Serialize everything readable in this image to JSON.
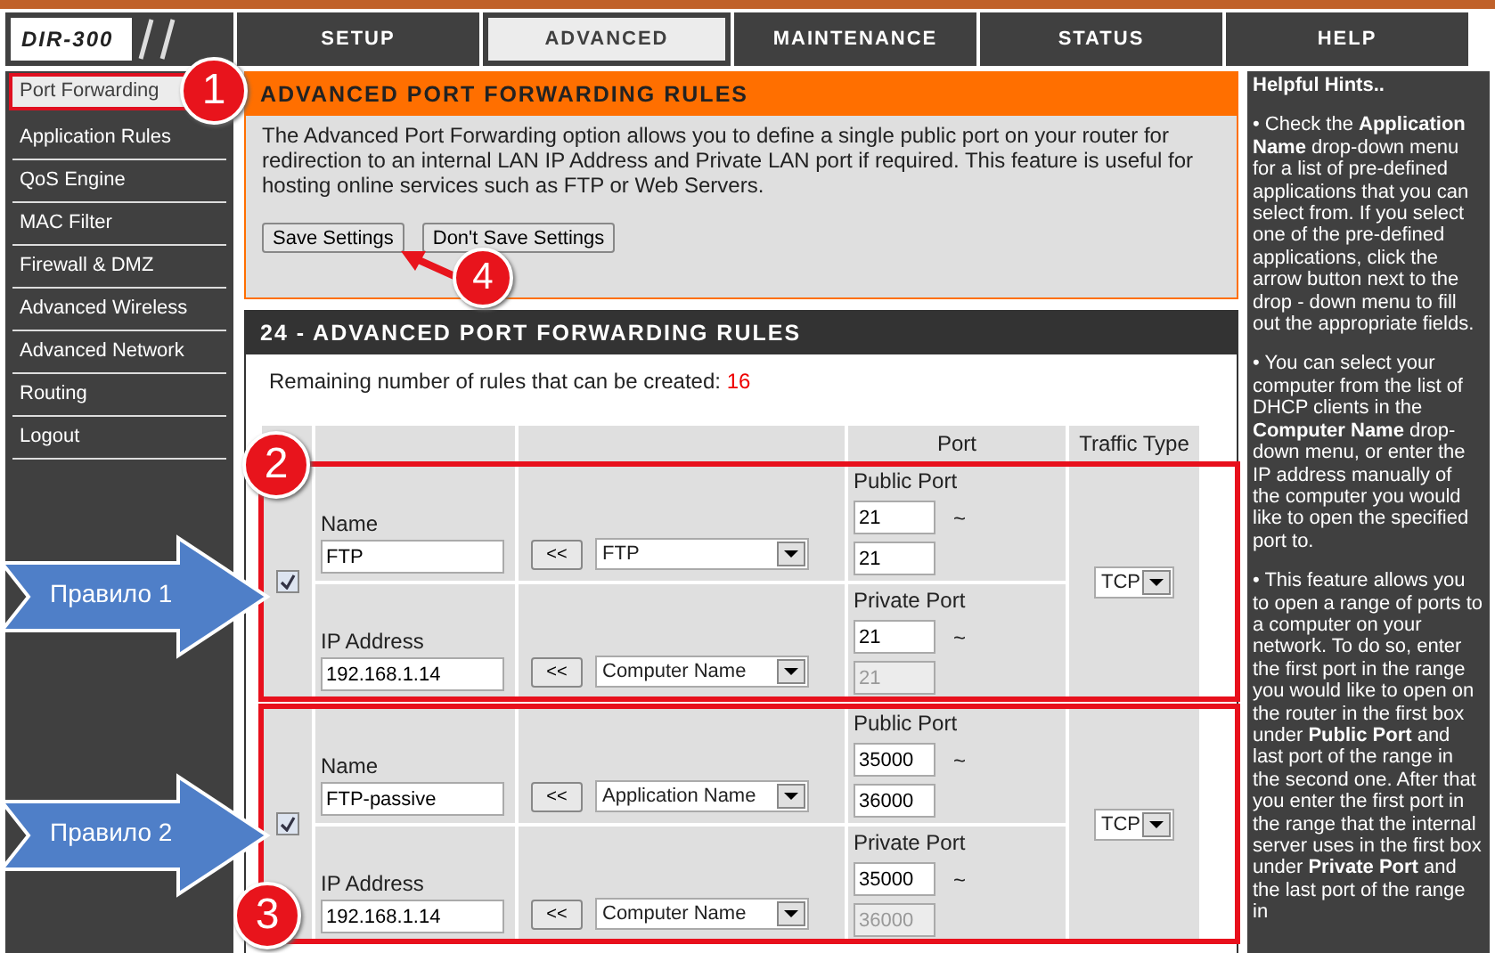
{
  "logo": "DIR-300",
  "tabs": [
    {
      "label": "SETUP",
      "selected": false
    },
    {
      "label": "ADVANCED",
      "selected": true
    },
    {
      "label": "MAINTENANCE",
      "selected": false
    },
    {
      "label": "STATUS",
      "selected": false
    },
    {
      "label": "HELP",
      "selected": false
    }
  ],
  "sidebar": {
    "items": [
      {
        "label": "Port Forwarding",
        "selected": true
      },
      {
        "label": "Application Rules",
        "selected": false
      },
      {
        "label": "QoS Engine",
        "selected": false
      },
      {
        "label": "MAC Filter",
        "selected": false
      },
      {
        "label": "Firewall & DMZ",
        "selected": false
      },
      {
        "label": "Advanced Wireless",
        "selected": false
      },
      {
        "label": "Advanced Network",
        "selected": false
      },
      {
        "label": "Routing",
        "selected": false
      },
      {
        "label": "Logout",
        "selected": false
      }
    ]
  },
  "intro": {
    "title": "ADVANCED PORT FORWARDING RULES",
    "text": "The Advanced Port Forwarding option allows you to define a single public port on your router for redirection to an internal LAN IP Address and Private LAN port if required. This feature is useful for hosting online services such as FTP or Web Servers.",
    "buttons": [
      "Save Settings",
      "Don't Save Settings"
    ]
  },
  "rules": {
    "title": "24 - ADVANCED PORT FORWARDING RULES",
    "remaining_label": "Remaining number of rules that can be created:",
    "remaining_count": "16",
    "columns": [
      "Port",
      "Traffic Type"
    ],
    "rows": [
      {
        "checked": true,
        "name_label": "Name",
        "name": "FTP",
        "copy_button": "<<",
        "app_select": "FTP",
        "ip_label": "IP Address",
        "ip": "192.168.1.14",
        "computer_select": "Computer Name",
        "public_label": "Public Port",
        "public_start": "21",
        "public_end": "21",
        "private_label": "Private Port",
        "private_start": "21",
        "private_end": "21",
        "private_end_disabled": true,
        "range_sep": "~",
        "traffic": "TCP"
      },
      {
        "checked": true,
        "name_label": "Name",
        "name": "FTP-passive",
        "copy_button": "<<",
        "app_select": "Application Name",
        "ip_label": "IP Address",
        "ip": "192.168.1.14",
        "computer_select": "Computer Name",
        "public_label": "Public Port",
        "public_start": "35000",
        "public_end": "36000",
        "private_label": "Private Port",
        "private_start": "35000",
        "private_end": "36000",
        "private_end_disabled": true,
        "range_sep": "~",
        "traffic": "TCP"
      }
    ]
  },
  "hints": {
    "title": "Helpful Hints..",
    "paragraphs": [
      "• Check the **Application Name** drop-down menu for a list of pre-defined applications that you can select from. If you select one of the pre-defined applications, click the arrow button next to the drop - down menu to fill out the appropriate fields.",
      "• You can select your computer from the list of DHCP clients in the **Computer Name** drop-down menu, or enter the IP address manually of the computer you would like to open the specified port to.",
      "• This feature allows you to open a range of ports to a computer on your network. To do so, enter the first port in the range you would like to open on the router in the first box under **Public Port** and last port of the range in the second one. After that you enter the first port in the range that the internal server uses in the first box under **Private Port** and the last port of the range in"
    ]
  },
  "annotations": {
    "badges": [
      "1",
      "4",
      "2",
      "3"
    ],
    "callouts": [
      "Правило 1",
      "Правило 2"
    ]
  }
}
